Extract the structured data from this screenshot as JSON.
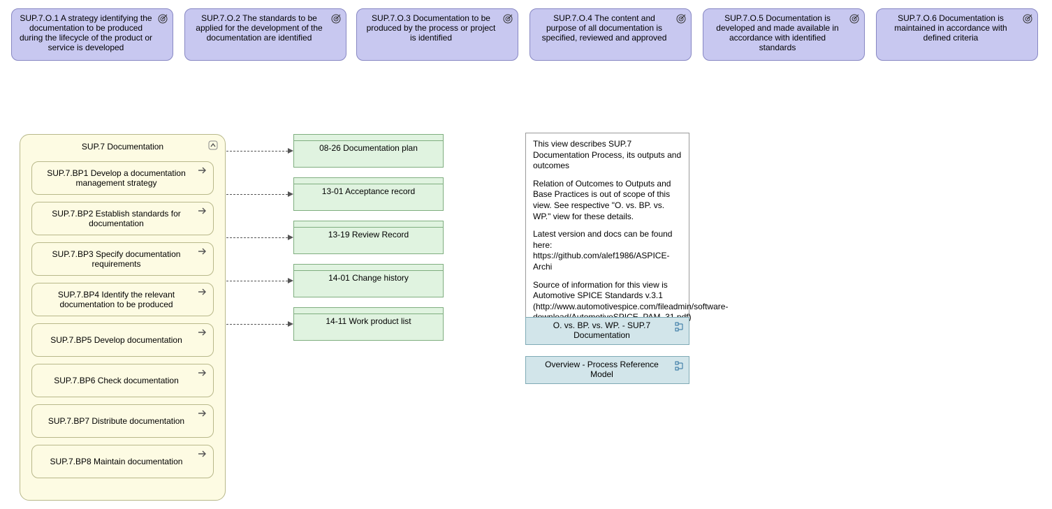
{
  "outcomes": [
    {
      "label": "SUP.7.O.1 A strategy identifying the documentation to be produced during the lifecycle of the product or service is developed"
    },
    {
      "label": "SUP.7.O.2 The standards to be applied for the development of the documentation are identified"
    },
    {
      "label": "SUP.7.O.3 Documentation to be produced by the process or project is identified"
    },
    {
      "label": "SUP.7.O.4 The content and purpose of all documentation is specified, reviewed and approved"
    },
    {
      "label": "SUP.7.O.5 Documentation is developed and made available in accordance with identified standards"
    },
    {
      "label": "SUP.7.O.6 Documentation is maintained in accordance with defined criteria"
    }
  ],
  "process": {
    "title": "SUP.7 Documentation",
    "bps": [
      "SUP.7.BP1 Develop a documentation management strategy",
      "SUP.7.BP2 Establish standards for documentation",
      "SUP.7.BP3 Specify documentation requirements",
      "SUP.7.BP4 Identify the relevant documentation to be produced",
      "SUP.7.BP5 Develop documentation",
      "SUP.7.BP6 Check documentation",
      "SUP.7.BP7 Distribute documentation",
      "SUP.7.BP8 Maintain documentation"
    ]
  },
  "work_products": [
    "08-26 Documentation plan",
    "13-01 Acceptance record",
    "13-19 Review Record",
    "14-01 Change history",
    "14-11 Work product list"
  ],
  "note": {
    "p1": "This view describes SUP.7 Documentation Process, its outputs and outcomes",
    "p2": "Relation of Outcomes to Outputs and Base Practices is out of scope of this view. See respective \"O. vs. BP. vs. WP.\" view for these details.",
    "p3": "Latest version and docs can be found here: https://github.com/alef1986/ASPICE-Archi",
    "p4": "Source of information for this view is Automotive SPICE Standards v.3.1 (http://www.automotivespice.com/fileadmin/software-download/AutomotiveSPICE_PAM_31.pdf)"
  },
  "view_links": [
    "O. vs. BP. vs. WP. - SUP.7 Documentation",
    "Overview - Process Reference Model"
  ]
}
